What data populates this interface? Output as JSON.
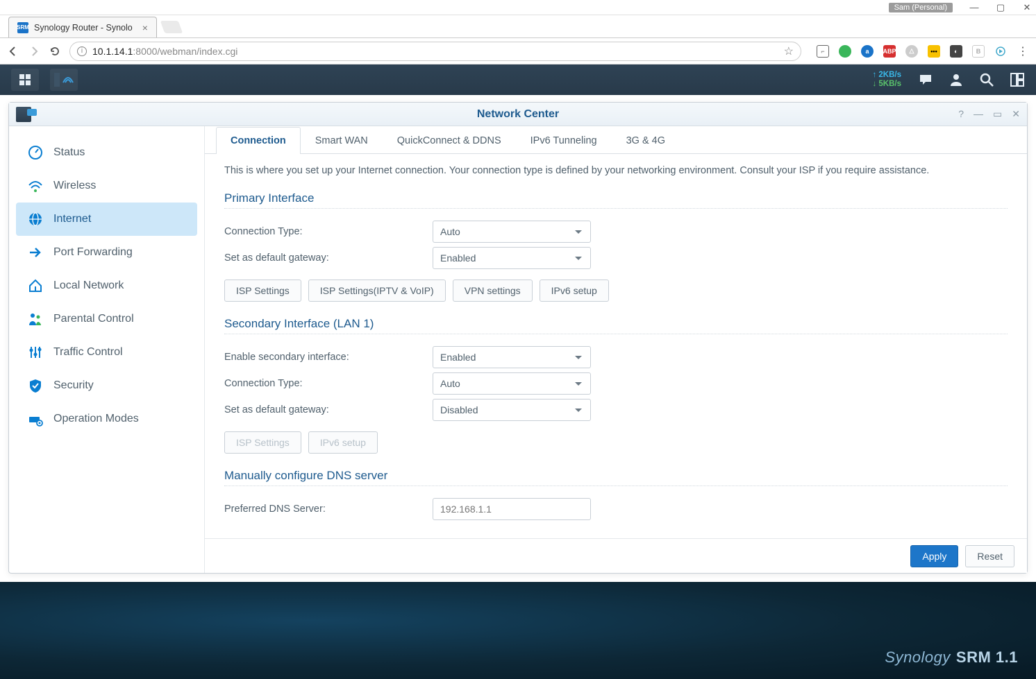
{
  "os": {
    "profile": "Sam (Personal)"
  },
  "browser": {
    "tab_title": "Synology Router - Synolo",
    "url_host": "10.1.14.1",
    "url_path": ":8000/webman/index.cgi"
  },
  "srm_top": {
    "up": "2KB/s",
    "down": "5KB/s"
  },
  "window": {
    "title": "Network Center",
    "sidebar": [
      {
        "label": "Status"
      },
      {
        "label": "Wireless"
      },
      {
        "label": "Internet"
      },
      {
        "label": "Port Forwarding"
      },
      {
        "label": "Local Network"
      },
      {
        "label": "Parental Control"
      },
      {
        "label": "Traffic Control"
      },
      {
        "label": "Security"
      },
      {
        "label": "Operation Modes"
      }
    ],
    "tabs": [
      {
        "label": "Connection"
      },
      {
        "label": "Smart WAN"
      },
      {
        "label": "QuickConnect & DDNS"
      },
      {
        "label": "IPv6 Tunneling"
      },
      {
        "label": "3G & 4G"
      }
    ],
    "intro": "This is where you set up your Internet connection. Your connection type is defined by your networking environment. Consult your ISP if you require assistance.",
    "primary": {
      "heading": "Primary Interface",
      "conn_type_label": "Connection Type:",
      "conn_type_value": "Auto",
      "gateway_label": "Set as default gateway:",
      "gateway_value": "Enabled",
      "buttons": [
        "ISP Settings",
        "ISP Settings(IPTV & VoIP)",
        "VPN settings",
        "IPv6 setup"
      ]
    },
    "secondary": {
      "heading": "Secondary Interface (LAN 1)",
      "enable_label": "Enable secondary interface:",
      "enable_value": "Enabled",
      "conn_type_label": "Connection Type:",
      "conn_type_value": "Auto",
      "gateway_label": "Set as default gateway:",
      "gateway_value": "Disabled",
      "buttons": [
        "ISP Settings",
        "IPv6 setup"
      ]
    },
    "dns": {
      "heading": "Manually configure DNS server",
      "preferred_label": "Preferred DNS Server:",
      "preferred_placeholder": "192.168.1.1"
    },
    "footer": {
      "apply": "Apply",
      "reset": "Reset"
    }
  },
  "brand": {
    "name": "Synology",
    "product": "SRM 1.1"
  }
}
